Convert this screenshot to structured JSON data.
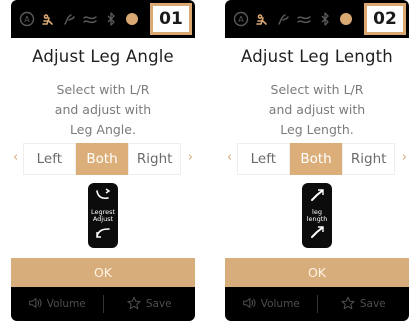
{
  "screens": [
    {
      "number": "01",
      "title": "Adjust Leg Angle",
      "instruction": "Select with L/R\nand adjust with\nLeg Angle.",
      "options": [
        "Left",
        "Both",
        "Right"
      ],
      "selected_option": "Both",
      "badge_label": "Legrest\nAdjust",
      "ok_label": "OK",
      "volume_label": "Volume",
      "save_label": "Save"
    },
    {
      "number": "02",
      "title": "Adjust Leg Length",
      "instruction": "Select with L/R\nand adjust with\nLeg Length.",
      "options": [
        "Left",
        "Both",
        "Right"
      ],
      "selected_option": "Both",
      "badge_label": "leg\nlength",
      "ok_label": "OK",
      "volume_label": "Volume",
      "save_label": "Save"
    }
  ],
  "colors": {
    "accent": "#dcaf7a",
    "device_bg": "#000000",
    "dialog_bg": "#ffffff",
    "status_icon": "#5a5a5a",
    "status_icon_active": "#d9a873"
  },
  "status_icons": [
    "power-icon",
    "massage-chair-icon",
    "shoulder-icon",
    "wave-icon",
    "bluetooth-icon",
    "leg-massage-icon"
  ]
}
